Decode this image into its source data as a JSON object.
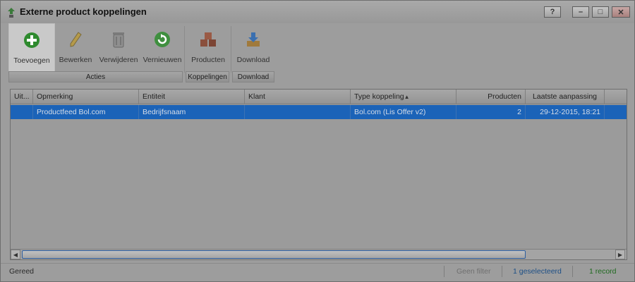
{
  "window": {
    "title": "Externe product koppelingen",
    "buttons": {
      "help": "?",
      "minimize": "–",
      "maximize": "□",
      "close": "✕"
    }
  },
  "toolbar": {
    "buttons": [
      {
        "label": "Toevoegen",
        "icon": "add-icon"
      },
      {
        "label": "Bewerken",
        "icon": "pencil-icon"
      },
      {
        "label": "Verwijderen",
        "icon": "trash-icon"
      },
      {
        "label": "Vernieuwen",
        "icon": "refresh-icon"
      },
      {
        "label": "Producten",
        "icon": "boxes-icon"
      },
      {
        "label": "Download",
        "icon": "download-icon"
      }
    ],
    "groups": [
      "Acties",
      "Koppelingen",
      "Download"
    ]
  },
  "grid": {
    "columns": [
      "Uit...",
      "Opmerking",
      "Entiteit",
      "Klant",
      "Type koppeling",
      "Producten",
      "Laatste aanpassing"
    ],
    "rows": [
      {
        "uit": "",
        "opmerking": "Productfeed Bol.com",
        "entiteit": "Bedrijfsnaam",
        "klant": "",
        "type": "Bol.com (Lis Offer v2)",
        "producten": "2",
        "laatste": "29-12-2015, 18:21"
      }
    ]
  },
  "status": {
    "state": "Gereed",
    "filter": "Geen filter",
    "selected": "1 geselecteerd",
    "records": "1 record"
  },
  "colors": {
    "selection": "#1b63b8",
    "accent_green": "#2e8a2e",
    "status_blue": "#1d4f86",
    "status_green": "#1f6a1f"
  }
}
